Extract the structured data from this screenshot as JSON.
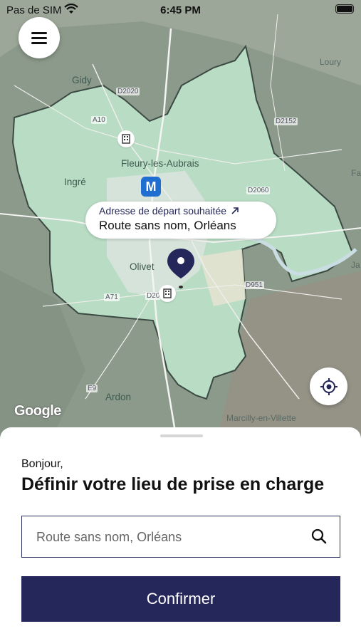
{
  "status_bar": {
    "carrier": "Pas de SIM",
    "time": "6:45 PM"
  },
  "map": {
    "labels": {
      "gidy": "Gidy",
      "loury": "Loury",
      "ingre": "Ingré",
      "fleury": "Fleury-les-Aubrais",
      "olivet": "Olivet",
      "ardon": "Ardon",
      "marcilly": "Marcilly-en-Villette",
      "fa": "Fa",
      "ja": "Ja"
    },
    "roads": {
      "d2020": "D2020",
      "a10": "A10",
      "d2152": "D2152",
      "d2060": "D2060",
      "d951": "D951",
      "a71": "A71",
      "d20": "D20",
      "e9": "E9"
    },
    "metro_letter": "M",
    "google_logo": "Google",
    "callout": {
      "label": "Adresse de départ souhaitée",
      "address": "Route sans nom, Orléans"
    }
  },
  "sheet": {
    "greeting": "Bonjour,",
    "title": "Définir votre lieu de prise en charge",
    "search": {
      "placeholder": "Route sans nom, Orléans"
    },
    "confirm_label": "Confirmer"
  },
  "colors": {
    "primary": "#25265a",
    "metro": "#1f6fd1",
    "zone": "#b9dcc4"
  },
  "icons": [
    "menu-icon",
    "locate-icon",
    "search-icon",
    "arrow-up-right-icon",
    "map-pin-icon",
    "building-icon",
    "wifi-icon",
    "battery-icon"
  ]
}
